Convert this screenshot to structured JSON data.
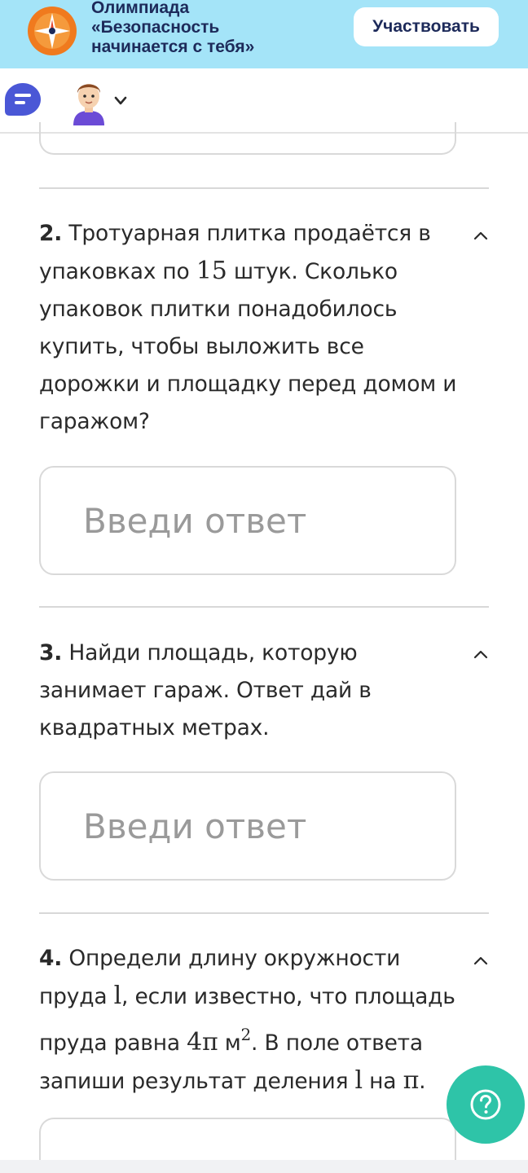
{
  "banner": {
    "title_lines": [
      "Олимпиада",
      "«Безопасность",
      "начинается с тебя»"
    ],
    "participate_label": "Участвовать",
    "accent_color": "#a4e4f8"
  },
  "toolbar": {
    "icons": [
      "chat-icon",
      "avatar",
      "chevron-down-icon"
    ]
  },
  "questions": [
    {
      "number": "2.",
      "text_parts": [
        "Тротуарная плитка продаётся в упаковках по ",
        "15",
        " штук. Сколько упаковок плитки понадобилось купить, чтобы выложить все дорожки и площадку перед домом и гаражом?"
      ],
      "placeholder": "Введи ответ"
    },
    {
      "number": "3.",
      "text": "Найди площадь, которую занимает гараж. Ответ дай в квадратных метрах.",
      "placeholder": "Введи ответ"
    },
    {
      "number": "4.",
      "text_parts": [
        "Определи длину окружности пруда ",
        "l",
        ", если известно, что площадь пруда равна ",
        "4π",
        " м",
        "2",
        ". В поле ответа запиши результат деления ",
        "l",
        " на ",
        "π",
        "."
      ]
    }
  ],
  "help_button": {
    "icon": "question-circle-icon",
    "color": "#2ec4a8"
  }
}
